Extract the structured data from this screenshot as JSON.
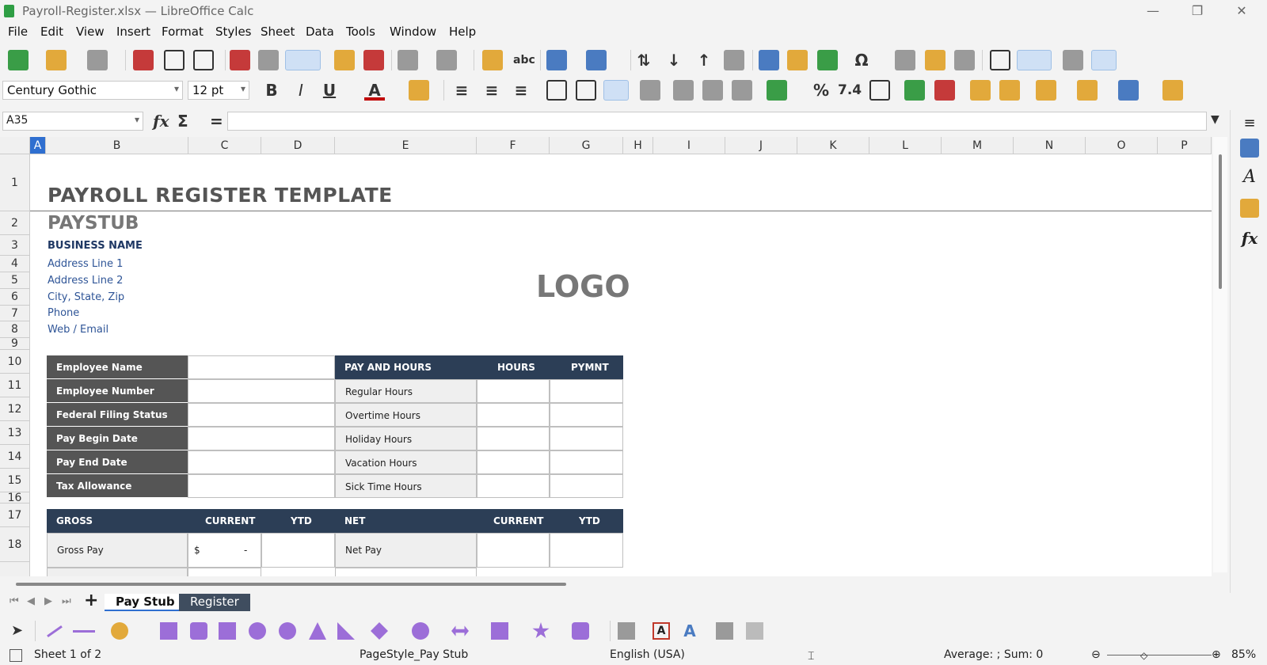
{
  "window": {
    "title": "Payroll-Register.xlsx — LibreOffice Calc",
    "minimize": "—",
    "restore": "❐",
    "close": "✕"
  },
  "menu": [
    "File",
    "Edit",
    "View",
    "Insert",
    "Format",
    "Styles",
    "Sheet",
    "Data",
    "Tools",
    "Window",
    "Help"
  ],
  "format_bar": {
    "font_name": "Century Gothic",
    "font_size": "12 pt",
    "bold": "B",
    "italic": "I",
    "underline": "U",
    "percent": "%",
    "number": "7.4"
  },
  "formula_bar": {
    "cell_ref": "A35",
    "fx": "fx",
    "sigma": "Σ",
    "equals": "=",
    "value": ""
  },
  "columns": [
    "A",
    "B",
    "C",
    "D",
    "E",
    "F",
    "G",
    "H",
    "I",
    "J",
    "K",
    "L",
    "M",
    "N",
    "O",
    "P"
  ],
  "rows": [
    "1",
    "2",
    "3",
    "4",
    "5",
    "6",
    "7",
    "8",
    "9",
    "10",
    "11",
    "12",
    "13",
    "14",
    "15",
    "16",
    "17",
    "18"
  ],
  "sheet": {
    "title": "PAYROLL REGISTER TEMPLATE",
    "subtitle": "PAYSTUB",
    "business_name": "BUSINESS NAME",
    "address": [
      "Address Line 1",
      "Address Line 2",
      "City, State, Zip",
      "Phone",
      "Web / Email"
    ],
    "logo": "LOGO",
    "employee_labels": [
      "Employee Name",
      "Employee Number",
      "Federal Filing Status",
      "Pay Begin Date",
      "Pay End Date",
      "Tax Allowance"
    ],
    "pay_header": {
      "title": "PAY AND HOURS",
      "hours": "HOURS",
      "pymnt": "PYMNT"
    },
    "pay_rows": [
      "Regular Hours",
      "Overtime Hours",
      "Holiday Hours",
      "Vacation Hours",
      "Sick Time Hours"
    ],
    "gross_header": {
      "title": "GROSS",
      "current": "CURRENT",
      "ytd": "YTD"
    },
    "net_header": {
      "title": "NET",
      "current": "CURRENT",
      "ytd": "YTD"
    },
    "gross_pay": {
      "label": "Gross Pay",
      "currency": "$",
      "value": "-"
    },
    "net_pay": {
      "label": "Net Pay"
    }
  },
  "tabs": {
    "add": "+",
    "sheets": [
      "Pay Stub",
      "Register"
    ]
  },
  "status": {
    "sheet": "Sheet 1 of 2",
    "page_style": "PageStyle_Pay Stub",
    "language": "English (USA)",
    "summary": "Average: ; Sum: 0",
    "zoom": "85%"
  },
  "colors": {
    "dark_label": "#555555",
    "navy_header": "#2c3e56",
    "accent": "#2f6fd0"
  }
}
